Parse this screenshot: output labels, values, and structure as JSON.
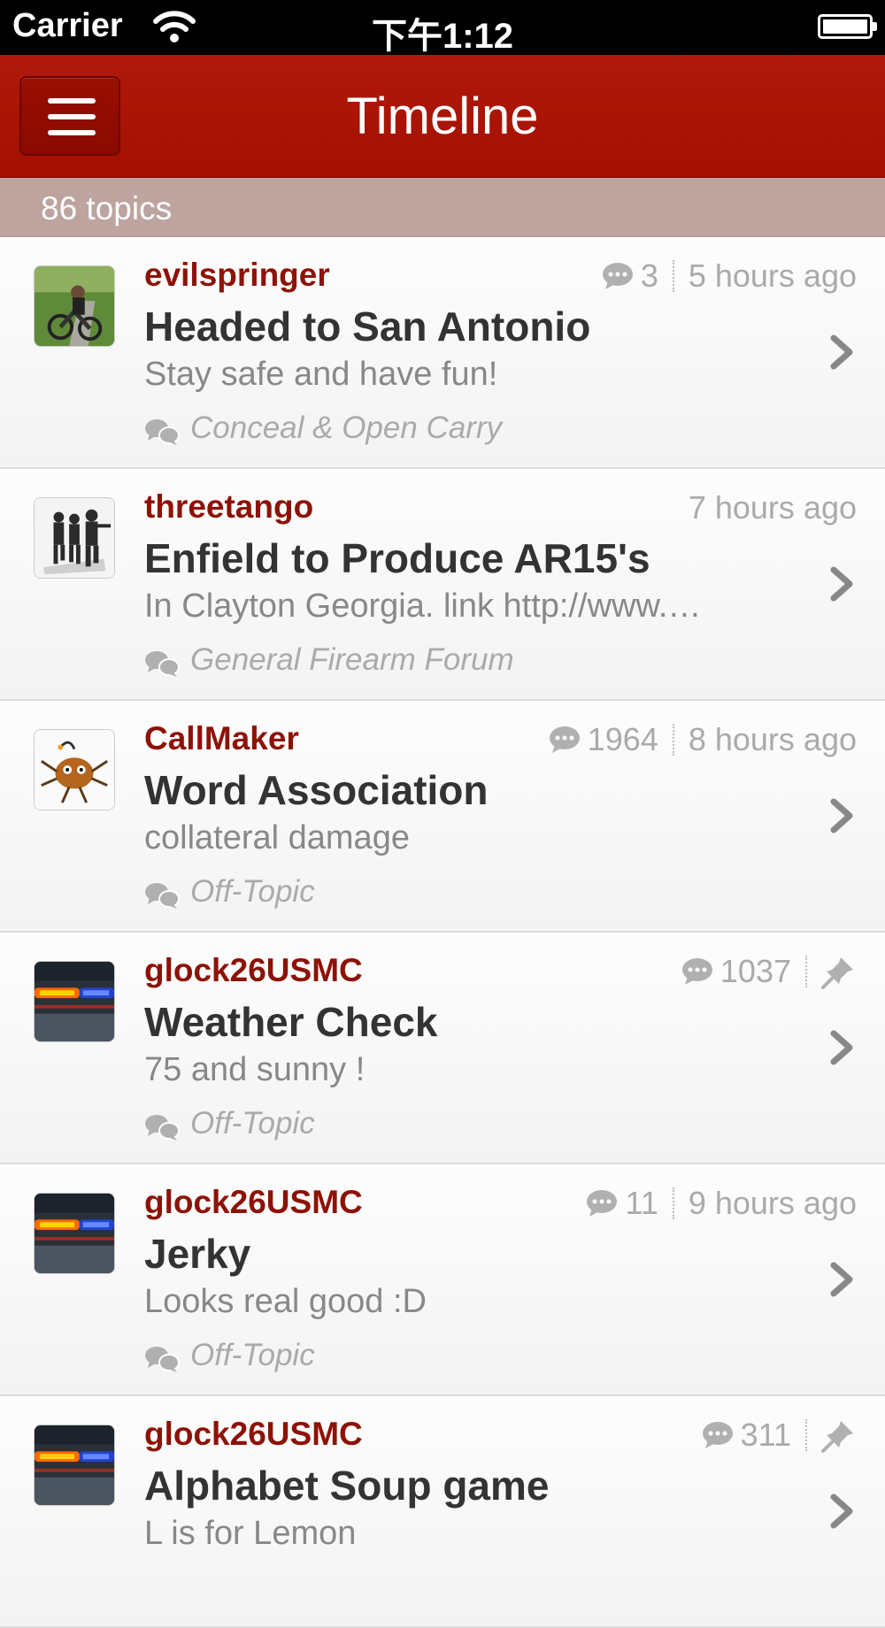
{
  "status_bar": {
    "carrier": "Carrier",
    "time": "下午1:12"
  },
  "nav": {
    "title": "Timeline"
  },
  "topics_count": "86 topics",
  "topics": [
    {
      "user": "evilspringer",
      "replies": "3",
      "time": "5 hours ago",
      "pinned": false,
      "title": "Headed to San Antonio",
      "excerpt": "Stay safe and have fun!",
      "forum": "Conceal & Open Carry",
      "avatar": "motorcycle-photo"
    },
    {
      "user": "threetango",
      "replies": "",
      "time": "7 hours ago",
      "pinned": false,
      "title": "Enfield to Produce AR15's",
      "excerpt": "In Clayton Georgia. link http://www.…",
      "forum": "General Firearm Forum",
      "avatar": "soldiers-silhouette"
    },
    {
      "user": "CallMaker",
      "replies": "1964",
      "time": "8 hours ago",
      "pinned": false,
      "title": "Word Association",
      "excerpt": "collateral damage",
      "forum": "Off-Topic",
      "avatar": "cartoon-creature"
    },
    {
      "user": "glock26USMC",
      "replies": "1037",
      "time": "",
      "pinned": true,
      "title": "Weather Check",
      "excerpt": "75 and sunny !",
      "forum": "Off-Topic",
      "avatar": "police-lights"
    },
    {
      "user": "glock26USMC",
      "replies": "11",
      "time": "9 hours ago",
      "pinned": false,
      "title": "Jerky",
      "excerpt": "Looks real good :D",
      "forum": "Off-Topic",
      "avatar": "police-lights"
    },
    {
      "user": "glock26USMC",
      "replies": "311",
      "time": "",
      "pinned": true,
      "title": "Alphabet Soup game",
      "excerpt": "L is for Lemon",
      "forum": "",
      "avatar": "police-lights"
    }
  ],
  "colors": {
    "nav": "#a31000",
    "username": "#8d1205",
    "count_bar": "#bda49f"
  }
}
